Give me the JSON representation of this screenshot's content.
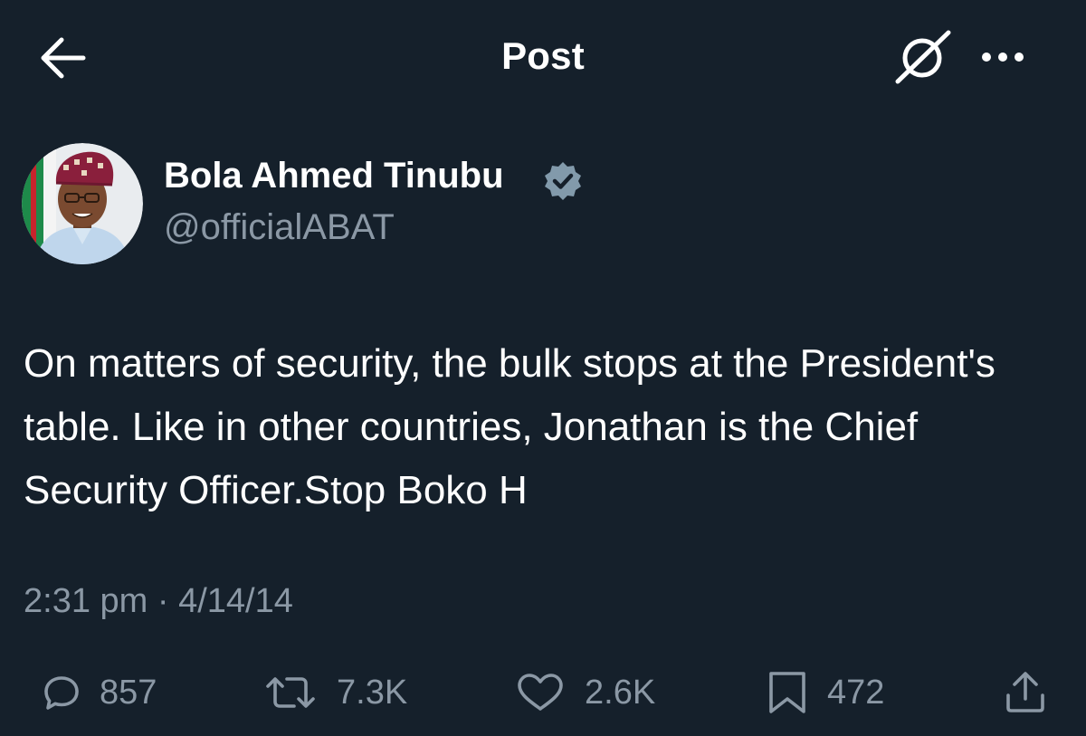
{
  "header": {
    "title": "Post",
    "back_icon": "arrow-left-icon",
    "grok_icon": "grok-icon",
    "more_icon": "more-dots-icon"
  },
  "author": {
    "name": "Bola Ahmed Tinubu",
    "handle": "@officialABAT",
    "verified": true,
    "verified_color": "#829aab"
  },
  "post": {
    "text": "On matters of security, the bulk stops at the President's table. Like in other countries, Jonathan is the Chief Security Officer.Stop Boko H",
    "time": "2:31 pm",
    "separator": "·",
    "date": "4/14/14"
  },
  "actions": {
    "replies": "857",
    "reposts": "7.3K",
    "likes": "2.6K",
    "bookmarks": "472"
  },
  "colors": {
    "background": "#15202b",
    "text_primary": "#ffffff",
    "text_secondary": "#8b98a5"
  }
}
